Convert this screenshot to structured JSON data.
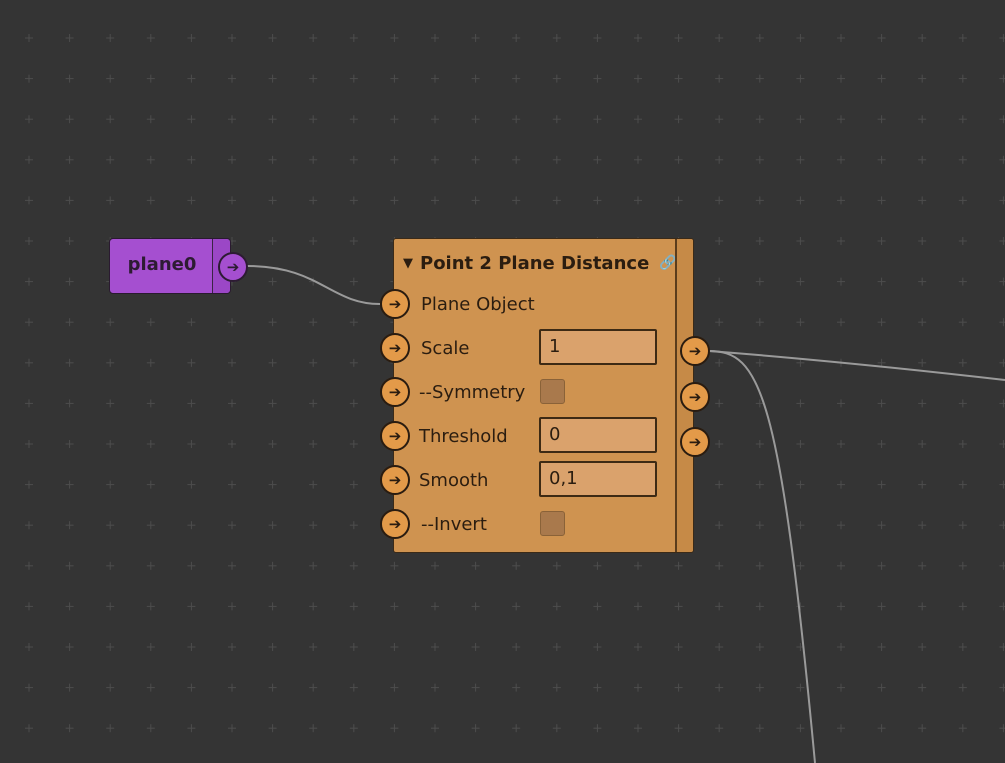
{
  "source_node": {
    "title": "plane0",
    "output_socket_icon": "arrow-right-icon",
    "color": "#a54fd0"
  },
  "node": {
    "title": "Point 2 Plane Distance",
    "collapse_icon": "triangle-down-icon",
    "link_icon": "link-icon",
    "color": "#cf9350",
    "params": [
      {
        "label": "Plane Object"
      },
      {
        "label": "Scale",
        "value": "1"
      },
      {
        "label": "--Symmetry",
        "checked": false
      },
      {
        "label": "Threshold",
        "value": "0"
      },
      {
        "label": "Smooth",
        "value": "0,1"
      },
      {
        "label": "--Invert",
        "checked": false
      }
    ],
    "socket_icon": "arrow-right-icon"
  },
  "canvas": {
    "background": "#343434",
    "grid_mark_color": "#4d4d4d",
    "wire_color": "#9a9a9a"
  }
}
